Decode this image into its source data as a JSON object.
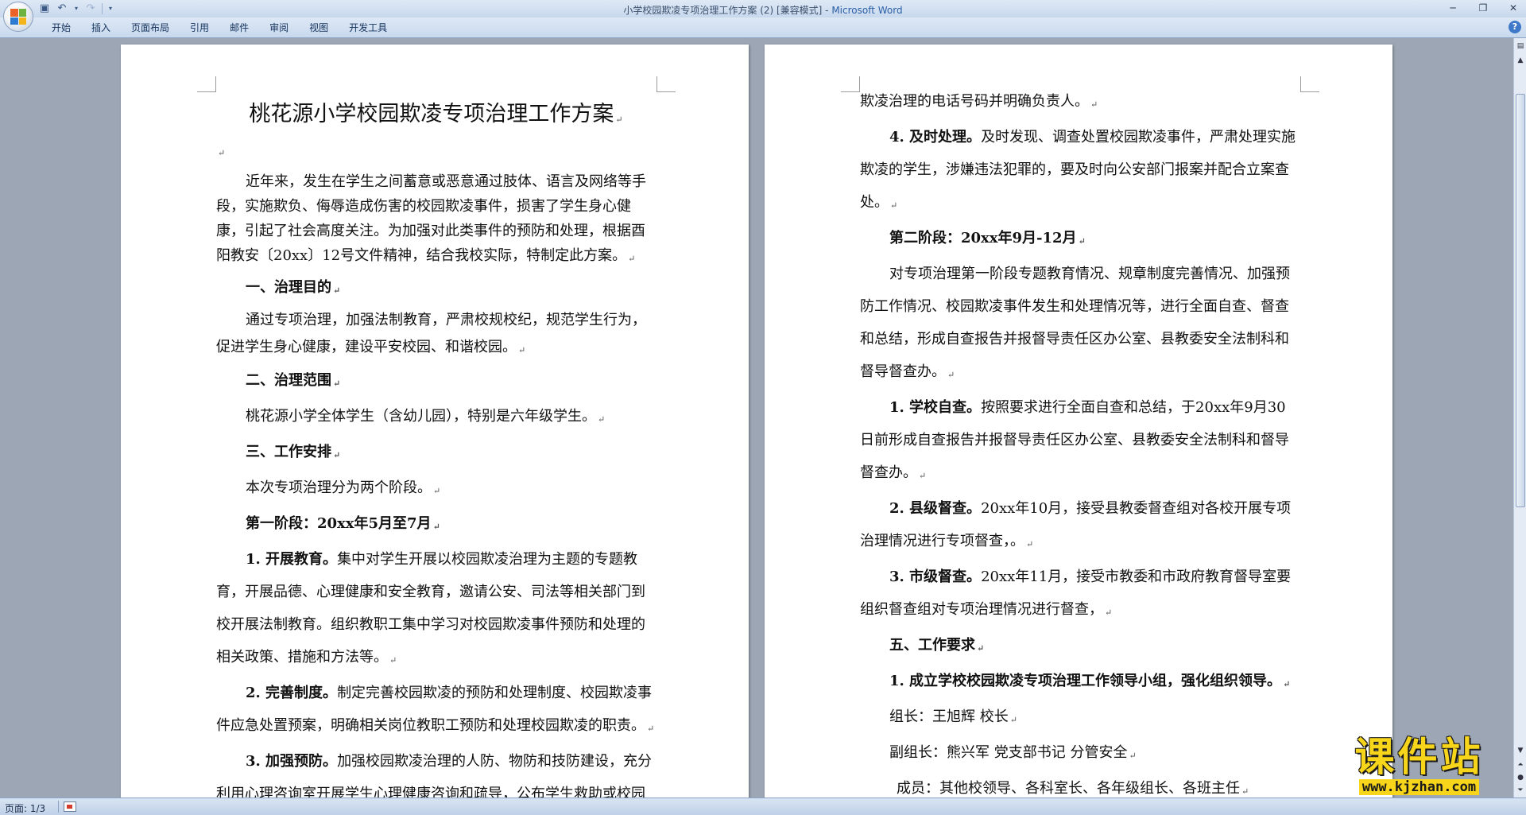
{
  "window": {
    "title_doc": "小学校园欺凌专项治理工作方案 (2) [兼容模式] - ",
    "title_app": "Microsoft Word"
  },
  "ribbon": {
    "tabs": [
      "开始",
      "插入",
      "页面布局",
      "引用",
      "邮件",
      "审阅",
      "视图",
      "开发工具"
    ],
    "help": "?"
  },
  "left_page": {
    "title": "桃花源小学校园欺凌专项治理工作方案",
    "p_intro": "近年来，发生在学生之间蓄意或恶意通过肢体、语言及网络等手段，实施欺负、侮辱造成伤害的校园欺凌事件，损害了学生身心健康，引起了社会高度关注。为加强对此类事件的预防和处理，根据酉阳教安〔20xx〕12号文件精神，结合我校实际，特制定此方案。",
    "h1": "一、治理目的",
    "p1": "通过专项治理，加强法制教育，严肃校规校纪，规范学生行为，促进学生身心健康，建设平安校园、和谐校园。",
    "h2": "二、治理范围",
    "p2": "桃花源小学全体学生（含幼儿园），特别是六年级学生。",
    "h3": "三、工作安排",
    "p3": "本次专项治理分为两个阶段。",
    "stage1": "第一阶段：20xx年5月至7月",
    "i1_label": "1. 开展教育。",
    "i1_text": "集中对学生开展以校园欺凌治理为主题的专题教育，开展品德、心理健康和安全教育，邀请公安、司法等相关部门到校开展法制教育。组织教职工集中学习对校园欺凌事件预防和处理的相关政策、措施和方法等。",
    "i2_label": "2. 完善制度。",
    "i2_text": "制定完善校园欺凌的预防和处理制度、校园欺凌事件应急处置预案，明确相关岗位教职工预防和处理校园欺凌的职责。",
    "i3_label": "3. 加强预防。",
    "i3_text": "加强校园欺凌治理的人防、物防和技防建设，充分利用心理咨询室开展学生心理健康咨询和疏导，公布学生救助或校园"
  },
  "right_page": {
    "p_cont": "欺凌治理的电话号码并明确负责人。",
    "i4_label": "4. 及时处理。",
    "i4_text": "及时发现、调查处置校园欺凌事件，严肃处理实施欺凌的学生，涉嫌违法犯罪的，要及时向公安部门报案并配合立案查处。",
    "stage2": "第二阶段：20xx年9月-12月",
    "p_stage2": "对专项治理第一阶段专题教育情况、规章制度完善情况、加强预防工作情况、校园欺凌事件发生和处理情况等，进行全面自查、督查和总结，形成自查报告并报督导责任区办公室、县教委安全法制科和督导督查办。",
    "s1_label": "1. 学校自查。",
    "s1_text": "按照要求进行全面自查和总结，于20xx年9月30日前形成自查报告并报督导责任区办公室、县教委安全法制科和督导督查办。",
    "s2_label": "2. 县级督查。",
    "s2_text": "20xx年10月，接受县教委督查组对各校开展专项治理情况进行专项督查，。",
    "s3_label": "3. 市级督查。",
    "s3_text": "20xx年11月，接受市教委和市政府教育督导室要组织督查组对专项治理情况进行督查，",
    "h5": "五、工作要求",
    "r1": "1.  成立学校校园欺凌专项治理工作领导小组，强化组织领导。",
    "leader": "组长：王旭辉  校长",
    "deputy": "副组长：熊兴军  党支部书记  分管安全",
    "members": "成员：其他校领导、各科室长、各年级组长、各班主任"
  },
  "status": {
    "page": "页面: 1/3"
  },
  "watermark": {
    "main": "课件站",
    "url": "www.kjzhan.com"
  },
  "para_mark": "↵"
}
